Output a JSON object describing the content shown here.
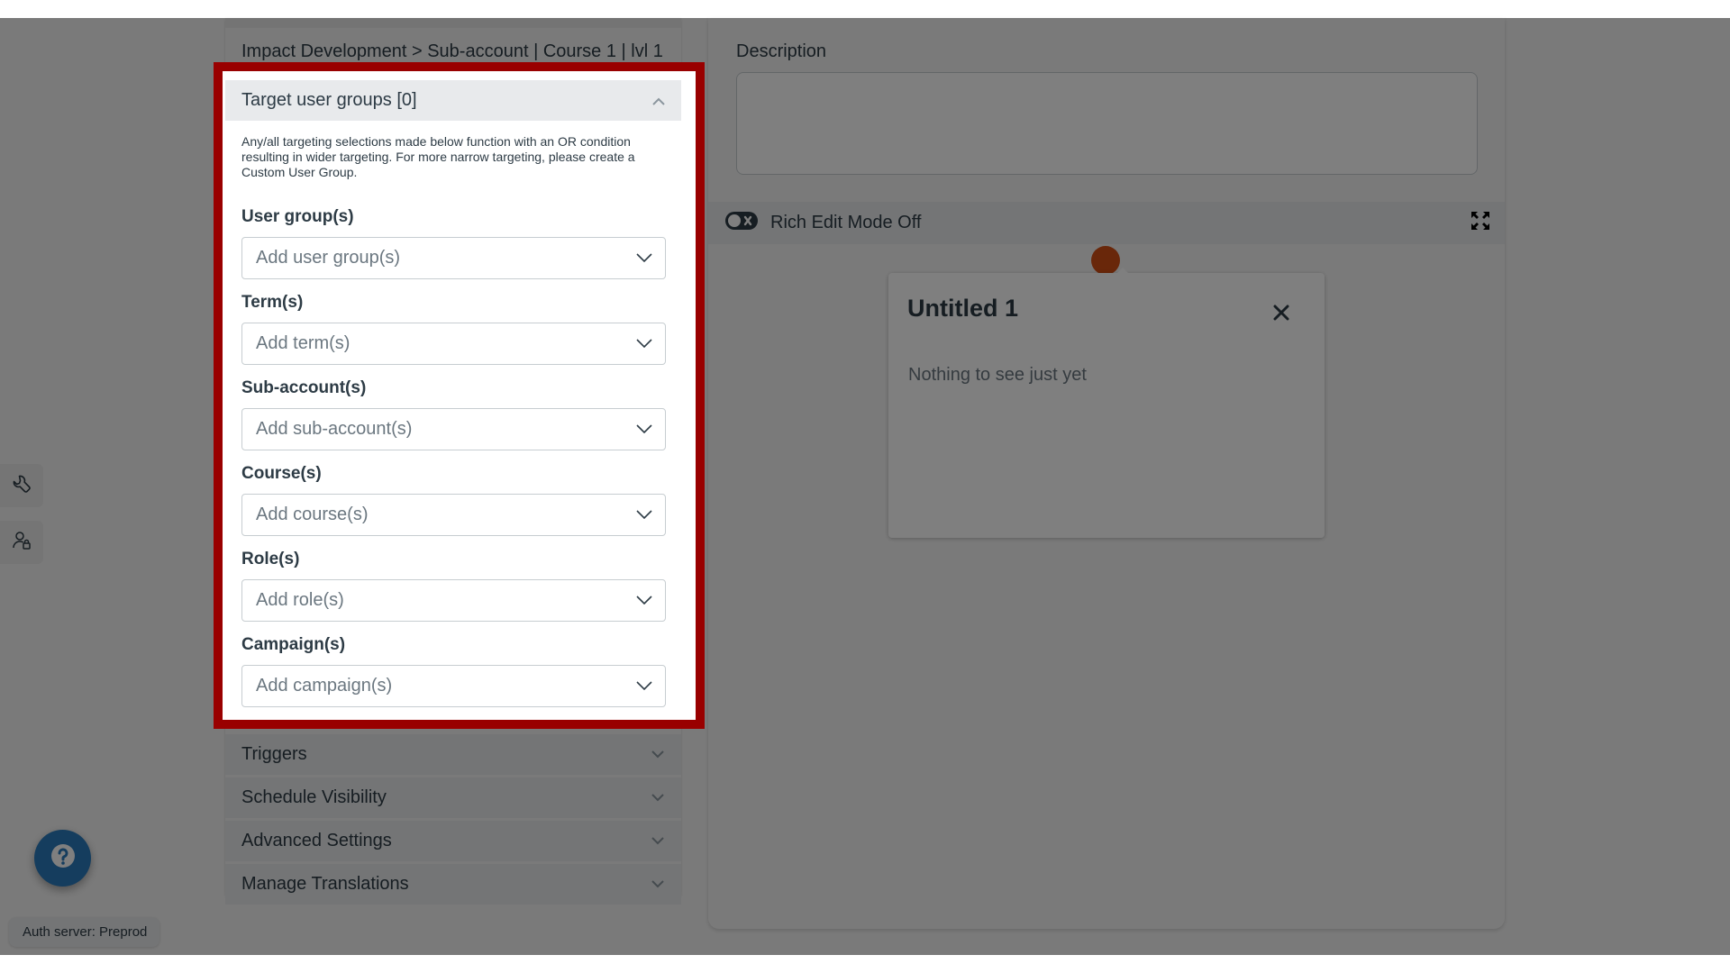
{
  "breadcrumb": "Impact Development > Sub-account | Course 1 | lvl 1",
  "target_user_groups": {
    "title": "Target user groups [0]",
    "note": "Any/all targeting selections made below function with an OR condition resulting in wider targeting. For more narrow targeting, please create a Custom User Group.",
    "fields": [
      {
        "label": "User group(s)",
        "placeholder": "Add user group(s)"
      },
      {
        "label": "Term(s)",
        "placeholder": "Add term(s)"
      },
      {
        "label": "Sub-account(s)",
        "placeholder": "Add sub-account(s)"
      },
      {
        "label": "Course(s)",
        "placeholder": "Add course(s)"
      },
      {
        "label": "Role(s)",
        "placeholder": "Add role(s)"
      },
      {
        "label": "Campaign(s)",
        "placeholder": "Add campaign(s)"
      }
    ]
  },
  "sections": [
    {
      "label": "Triggers"
    },
    {
      "label": "Schedule Visibility"
    },
    {
      "label": "Advanced Settings"
    },
    {
      "label": "Manage Translations"
    }
  ],
  "description": {
    "label": "Description",
    "value": ""
  },
  "editor_toolbar": {
    "rich_edit_label": "Rich Edit Mode Off",
    "rich_edit_on": false
  },
  "preview_card": {
    "title": "Untitled 1",
    "body": "Nothing to see just yet"
  },
  "sidebar_icons": [
    "wrench-icon",
    "user-lock-icon"
  ],
  "help_icon": "question-icon",
  "auth_badge": "Auth server: Preprod",
  "colors": {
    "highlight_border": "#990000",
    "help_button": "#2a7abc",
    "marker": "#d24e14",
    "text": "#2d3b45",
    "placeholder": "#6b7780"
  }
}
